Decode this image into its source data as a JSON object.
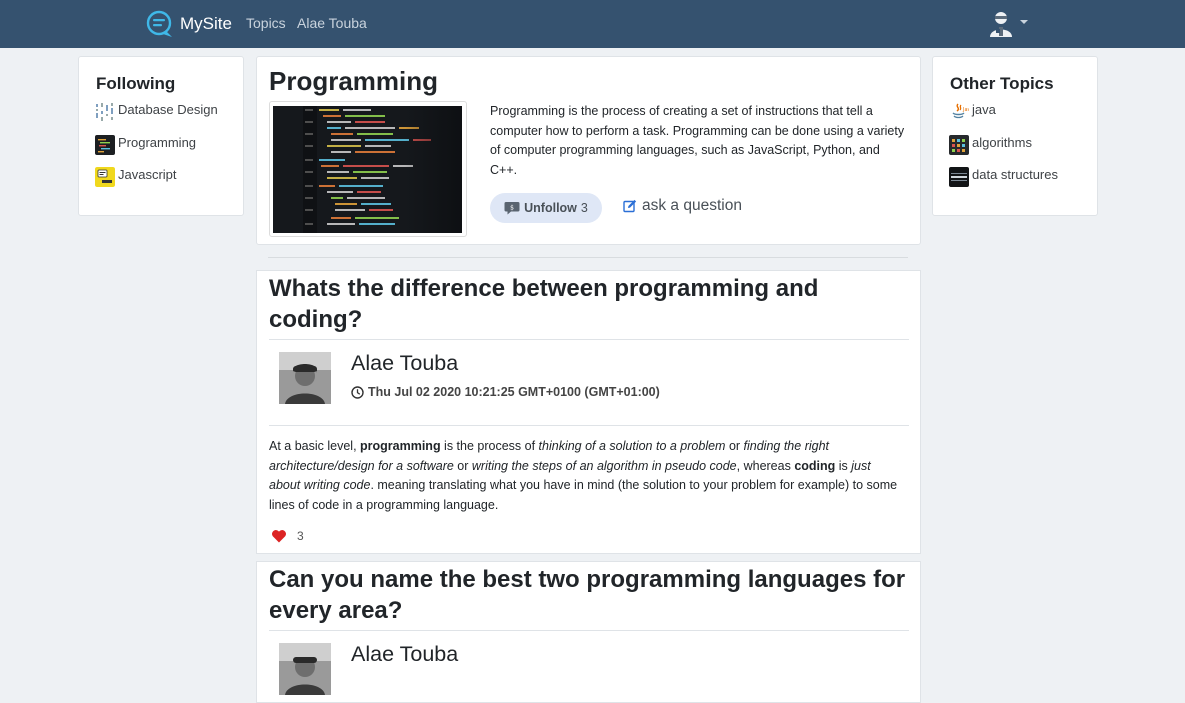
{
  "navbar": {
    "brand": "MySite",
    "links": [
      "Topics",
      "Alae Touba"
    ],
    "brand_color": "#35526f"
  },
  "following": {
    "title": "Following",
    "items": [
      {
        "label": "Database Design",
        "icon": "database-design-thumb"
      },
      {
        "label": "Programming",
        "icon": "programming-thumb"
      },
      {
        "label": "Javascript",
        "icon": "javascript-thumb"
      }
    ]
  },
  "topic": {
    "title": "Programming",
    "description": "Programming is the process of creating a set of instructions that tell a computer how to perform a task. Programming can be done using a variety of computer programming languages, such as JavaScript, Python, and C++.",
    "unfollow_label": "Unfollow",
    "followers": "3",
    "ask_label": "ask a question"
  },
  "other_topics": {
    "title": "Other Topics",
    "items": [
      {
        "label": "java",
        "icon": "java-thumb"
      },
      {
        "label": "algorithms",
        "icon": "algorithms-thumb"
      },
      {
        "label": "data structures",
        "icon": "data-structures-thumb"
      }
    ]
  },
  "questions": [
    {
      "title": "Whats the difference between programming and coding?",
      "author": "Alae Touba",
      "date": "Thu Jul 02 2020 10:21:25 GMT+0100 (GMT+01:00)",
      "body": [
        {
          "t": "At a basic level, "
        },
        {
          "t": "programming",
          "s": "b"
        },
        {
          "t": " is the process of "
        },
        {
          "t": "thinking of a solution to a problem",
          "s": "i"
        },
        {
          "t": " or "
        },
        {
          "t": "finding the right architecture/design for a software",
          "s": "i"
        },
        {
          "t": "  or "
        },
        {
          "t": "writing the steps of an algorithm in pseudo code",
          "s": "i"
        },
        {
          "t": ", whereas "
        },
        {
          "t": "coding",
          "s": "b"
        },
        {
          "t": " is "
        },
        {
          "t": "just about writing code",
          "s": "i"
        },
        {
          "t": ". meaning translating what you have in mind (the solution to your problem for example) to some lines of code in a programming language."
        }
      ],
      "likes": "3"
    },
    {
      "title": "Can you name the best two programming languages for every area?",
      "author": "Alae Touba"
    }
  ],
  "colors": {
    "navbar": "#35526f",
    "page_bg": "#eef1f4",
    "unfollow_bg": "#dfe7f6",
    "like_heart": "#dc2323",
    "ask_icon": "#2b6fd6"
  }
}
